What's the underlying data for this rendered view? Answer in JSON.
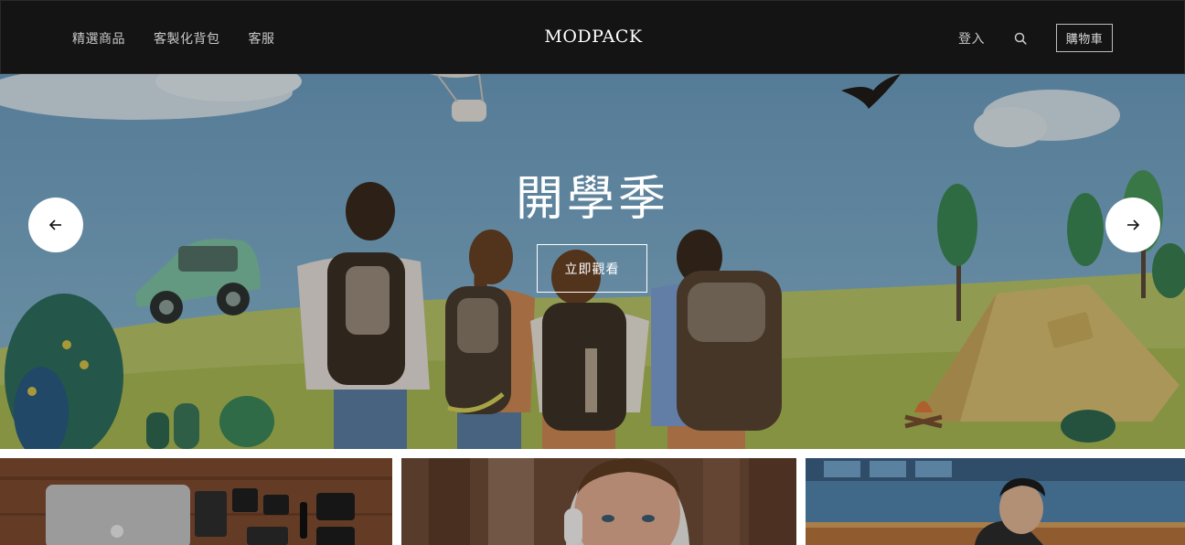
{
  "header": {
    "nav_left": [
      {
        "label": "精選商品"
      },
      {
        "label": "客製化背包"
      },
      {
        "label": "客服"
      }
    ],
    "logo": "MODPACK",
    "login_label": "登入",
    "search_icon": "search-icon",
    "cart_label": "購物車"
  },
  "hero": {
    "title": "開學季",
    "cta_label": "立即觀看",
    "prev_icon": "arrow-left-icon",
    "next_icon": "arrow-right-icon"
  },
  "thumbnails": [
    {
      "subject": "laptop and camera gear on wooden table"
    },
    {
      "subject": "woman with headphones"
    },
    {
      "subject": "man with backpack"
    }
  ],
  "colors": {
    "header_bg": "#141414",
    "nav_text": "#c9c9c9",
    "logo_text": "#ffffff"
  }
}
